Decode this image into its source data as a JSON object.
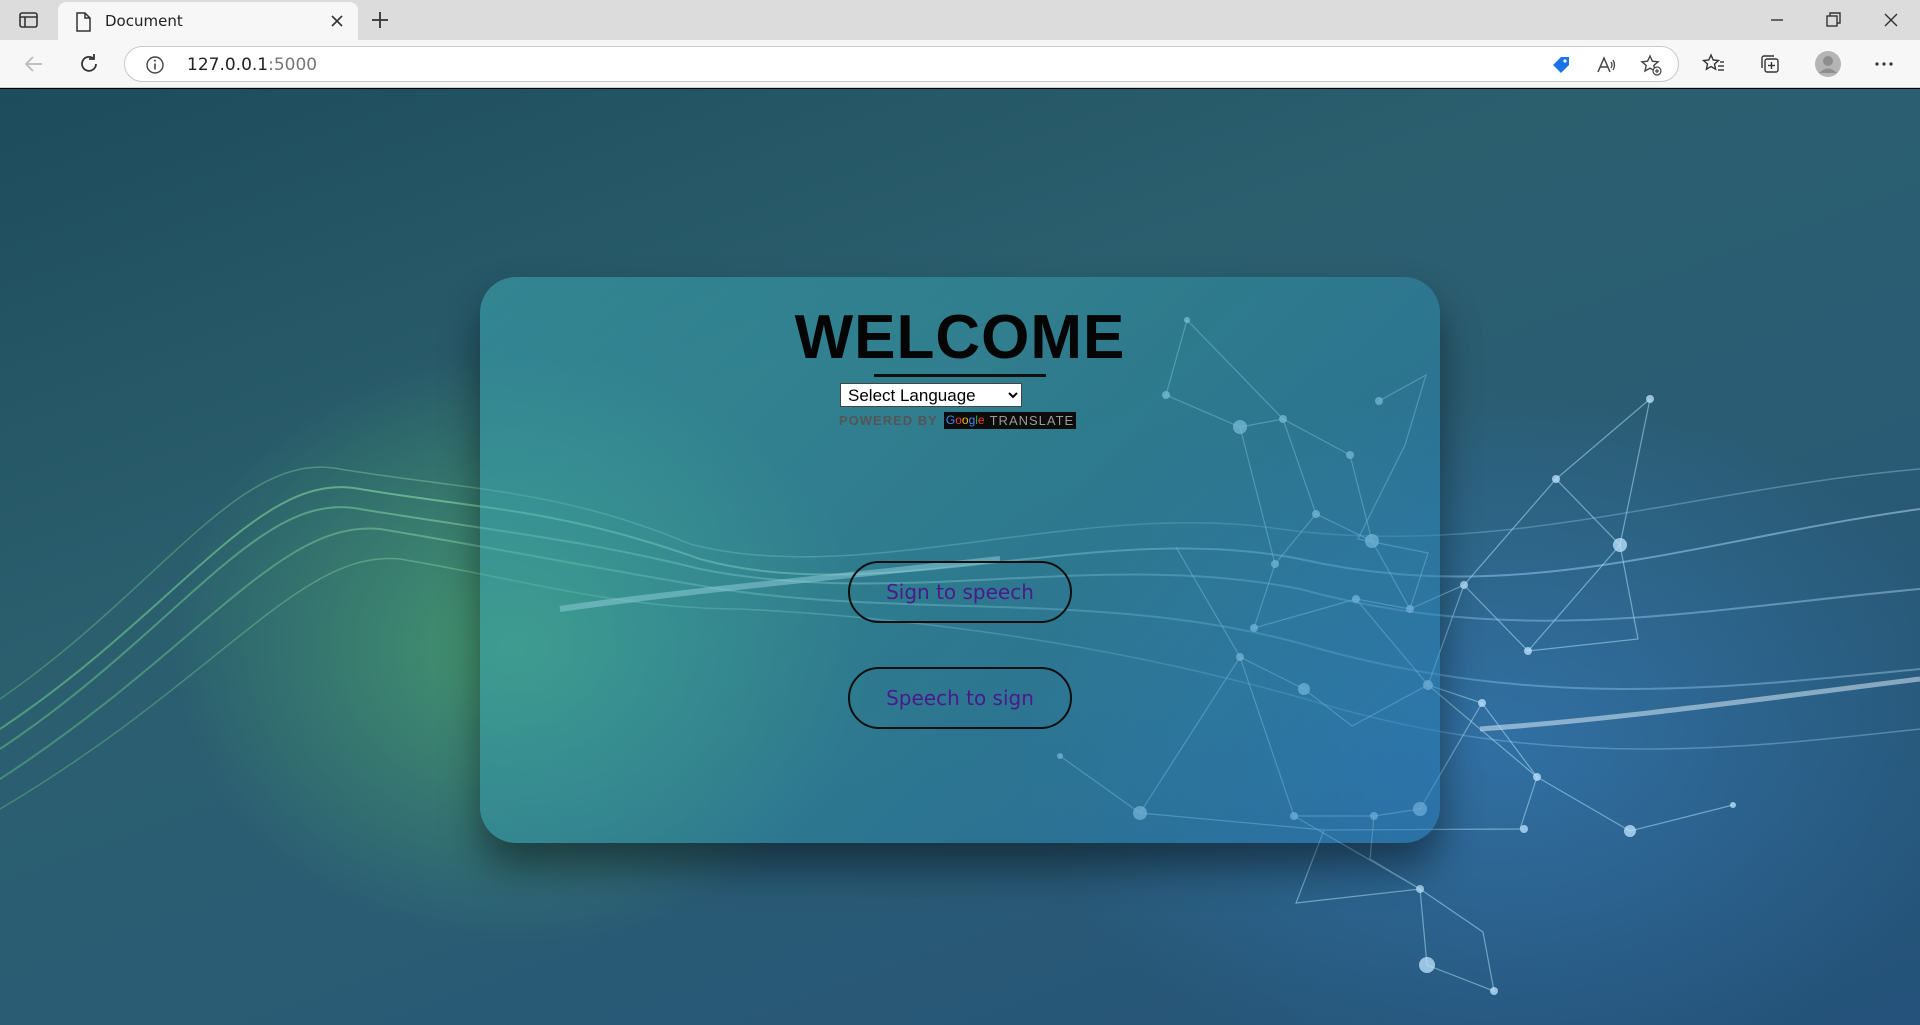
{
  "browser": {
    "tab_title": "Document",
    "url_host": "127.0.0.1",
    "url_port": ":5000"
  },
  "page": {
    "heading": "WELCOME",
    "language_select": {
      "selected": "Select Language"
    },
    "powered_by": "POWERED BY",
    "google_letters": [
      "G",
      "o",
      "o",
      "g",
      "l",
      "e"
    ],
    "translate": "TRANSLATE",
    "buttons": {
      "sign_to_speech": "Sign to speech",
      "speech_to_sign": "Speech to sign"
    }
  },
  "colors": {
    "button_text": "#4a1a8c",
    "heading": "#050505"
  }
}
